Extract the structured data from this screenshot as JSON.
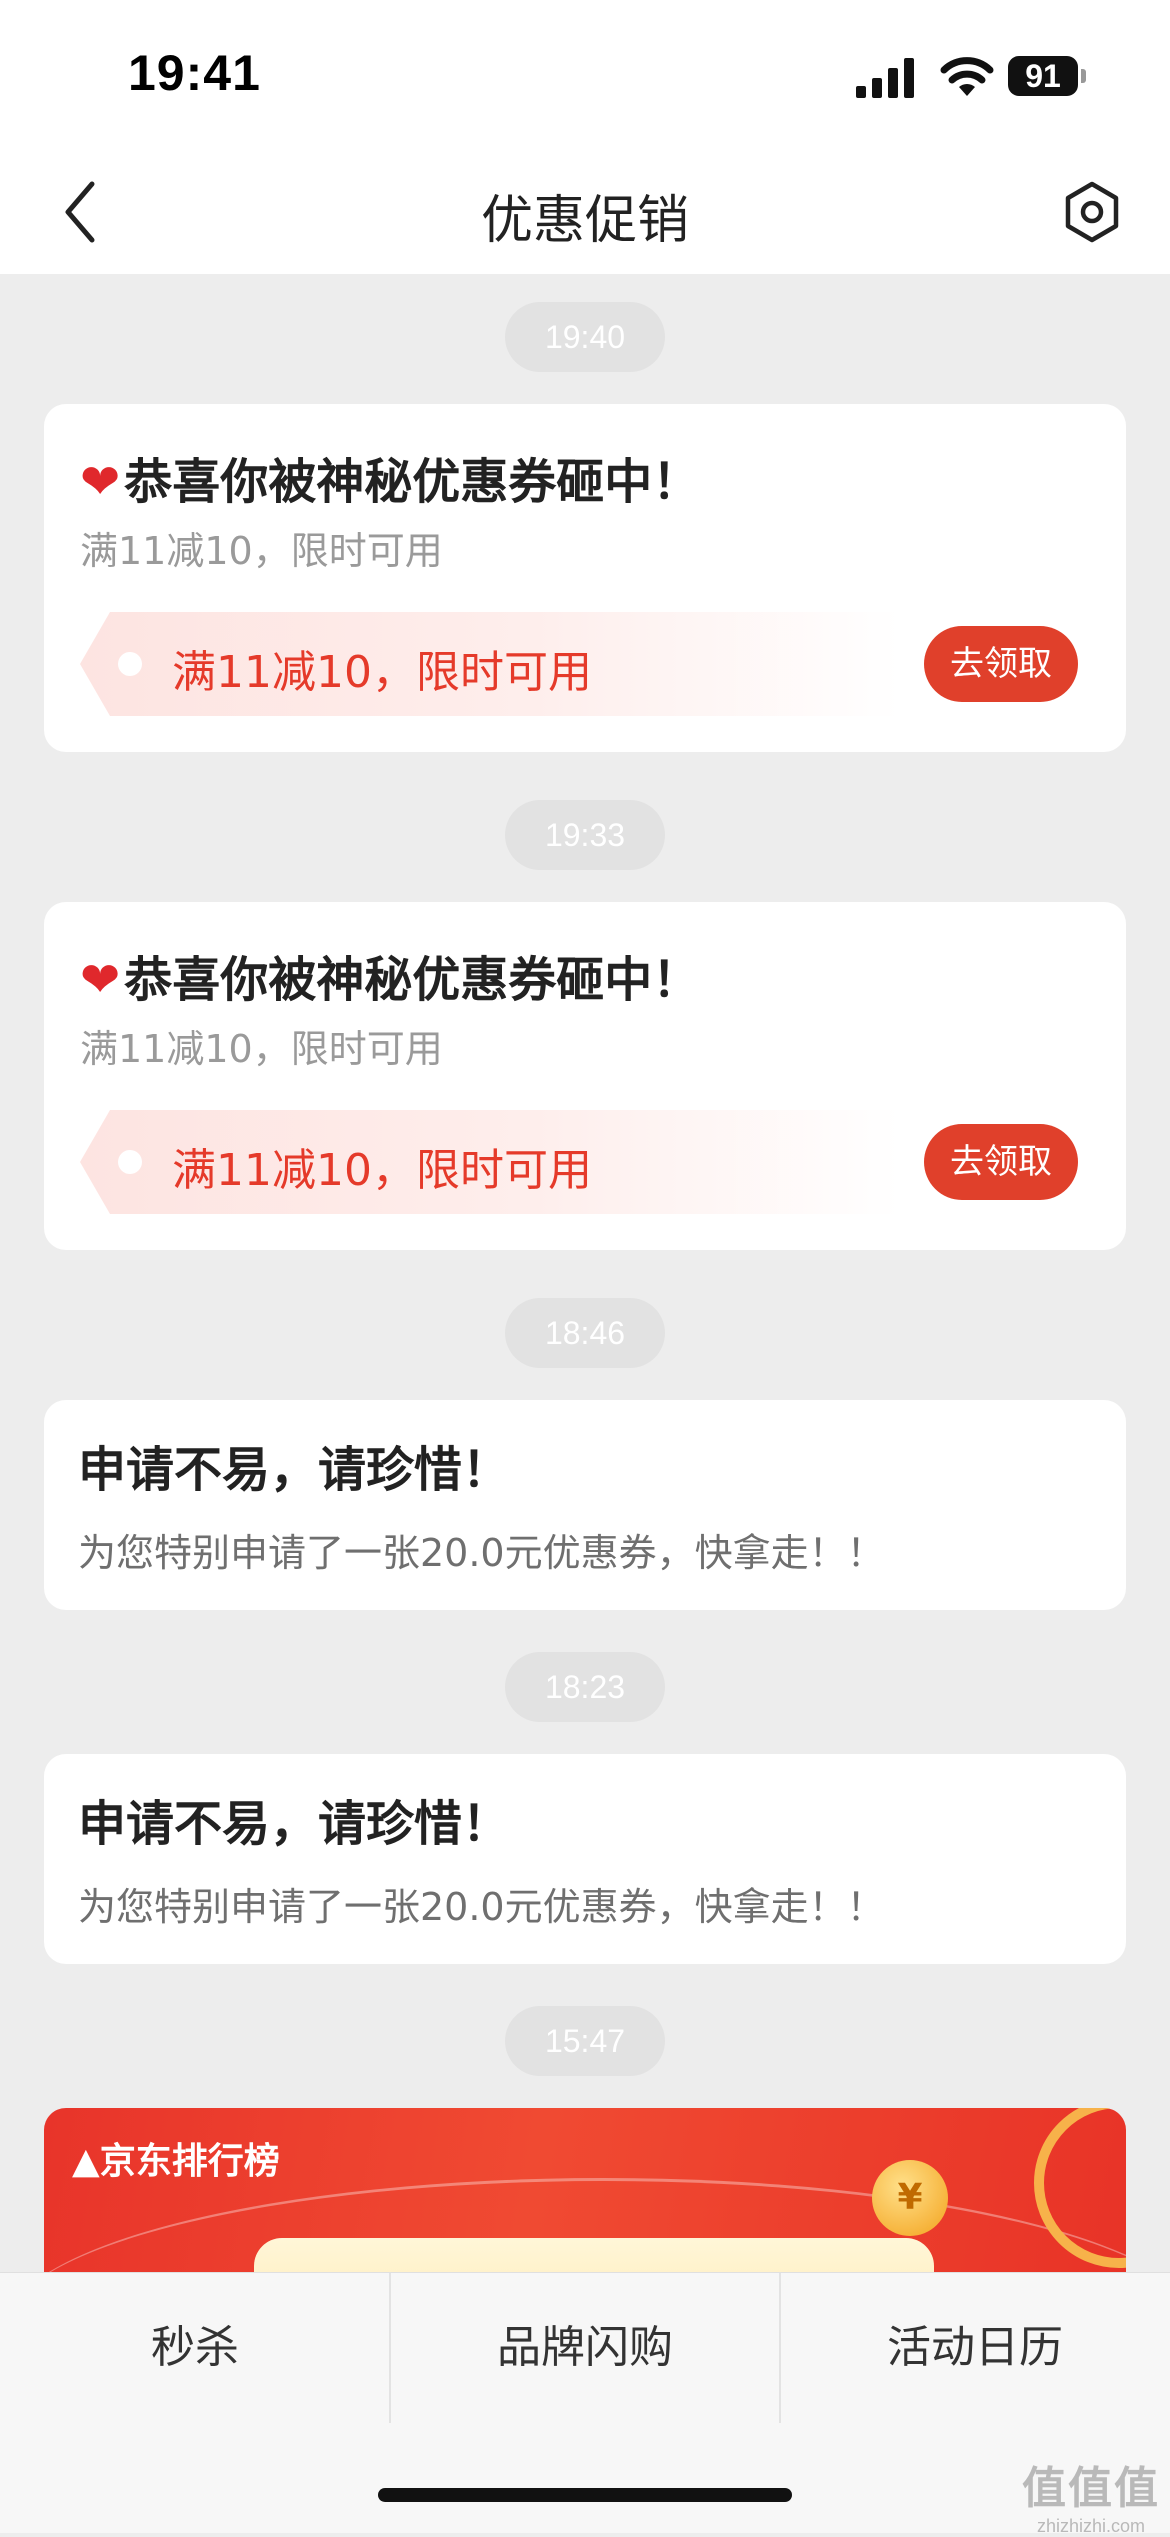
{
  "status_bar": {
    "time": "19:41",
    "battery": "91"
  },
  "nav": {
    "title": "优惠促销"
  },
  "messages": [
    {
      "time": "19:40",
      "title": "恭喜你被神秘优惠券砸中！",
      "subtitle": "满11减10，限时可用",
      "coupon_text": "满11减10，限时可用",
      "button": "去领取"
    },
    {
      "time": "19:33",
      "title": "恭喜你被神秘优惠券砸中！",
      "subtitle": "满11减10，限时可用",
      "coupon_text": "满11减10，限时可用",
      "button": "去领取"
    },
    {
      "time": "18:46",
      "title": "申请不易，请珍惜！",
      "subtitle": "为您特别申请了一张20.0元优惠券，快拿走！！"
    },
    {
      "time": "18:23",
      "title": "申请不易，请珍惜！",
      "subtitle": "为您特别申请了一张20.0元优惠券，快拿走！！"
    },
    {
      "time": "15:47",
      "banner_logo": "京东排行榜"
    }
  ],
  "tabs": [
    "秒杀",
    "品牌闪购",
    "活动日历"
  ],
  "watermark": {
    "big": "值值值",
    "small": "zhizhizhi.com"
  },
  "colors": {
    "accent": "#e0402b",
    "coupon_text": "#e53a2a",
    "background": "#ededed"
  },
  "icons": {
    "back": "chevron-left-icon",
    "settings": "hexagon-settings-icon",
    "heart": "red-heart-icon"
  }
}
